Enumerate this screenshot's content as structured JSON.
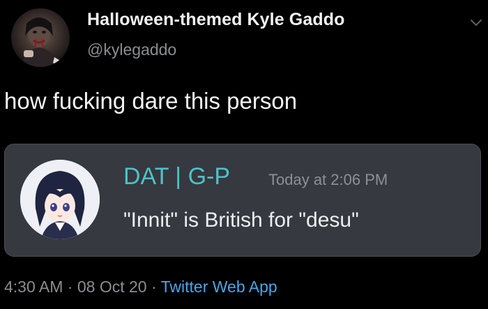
{
  "tweet": {
    "display_name": "Halloween-themed Kyle Gaddo",
    "handle": "@kylegaddo",
    "text": "how fucking dare this person",
    "time": "4:30 AM",
    "separator": "·",
    "date": "08 Oct 20",
    "source": "Twitter Web App",
    "avatar_icon": "profile-photo",
    "menu_icon": "chevron-down-icon"
  },
  "embed": {
    "username": "DAT | G-P",
    "timestamp": "Today at 2:06 PM",
    "message": "\"Innit\" is British for \"desu\"",
    "avatar_icon": "anime-avatar",
    "username_color": "#4ec1c8",
    "background_color": "#36393f"
  },
  "colors": {
    "background": "#000000",
    "link": "#4aa6e8",
    "secondary_text": "#8a8d91"
  }
}
